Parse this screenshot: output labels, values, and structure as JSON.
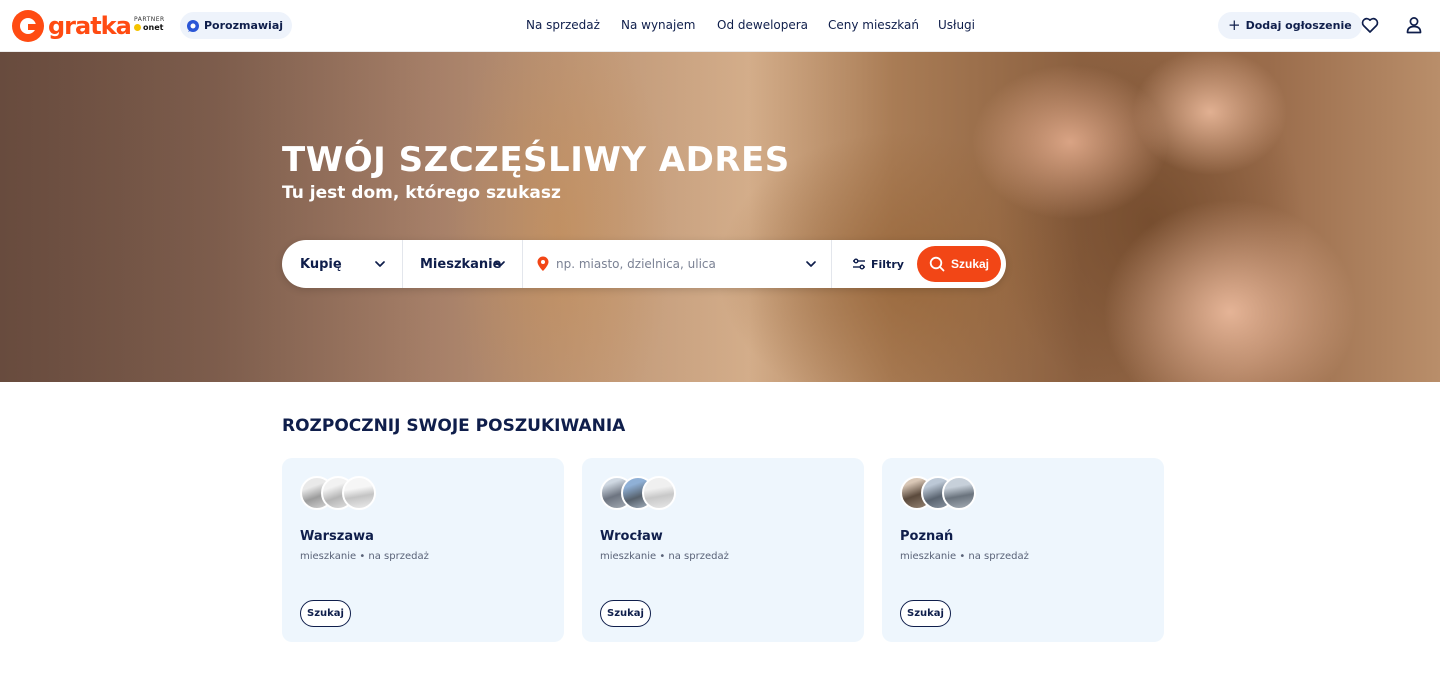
{
  "header": {
    "logo_text": "gratka",
    "partner_label": "PARTNER",
    "partner_brand": "onet",
    "chat_label": "Porozmawiaj",
    "nav": [
      {
        "label": "Na sprzedaż"
      },
      {
        "label": "Na wynajem"
      },
      {
        "label": "Od dewelopera"
      },
      {
        "label": "Ceny mieszkań"
      },
      {
        "label": "Usługi"
      }
    ],
    "add_label": "Dodaj ogłoszenie",
    "icons": {
      "favorites": "heart-icon",
      "account": "user-icon"
    }
  },
  "hero": {
    "title": "TWÓJ SZCZĘŚLIWY ADRES",
    "subtitle": "Tu jest dom, którego szukasz"
  },
  "search": {
    "transaction": "Kupię",
    "property_type": "Mieszkanie",
    "location_placeholder": "np. miasto, dzielnica, ulica",
    "filters_label": "Filtry",
    "submit_label": "Szukaj"
  },
  "start": {
    "title": "ROZPOCZNIJ SWOJE POSZUKIWANIA",
    "cards": [
      {
        "city": "Warszawa",
        "desc": "mieszkanie • na sprzedaż",
        "button": "Szukaj"
      },
      {
        "city": "Wrocław",
        "desc": "mieszkanie • na sprzedaż",
        "button": "Szukaj"
      },
      {
        "city": "Poznań",
        "desc": "mieszkanie • na sprzedaż",
        "button": "Szukaj"
      }
    ]
  },
  "colors": {
    "brand": "#ff4b12",
    "navy": "#0f1e4b",
    "card_bg": "#eef6fd"
  }
}
